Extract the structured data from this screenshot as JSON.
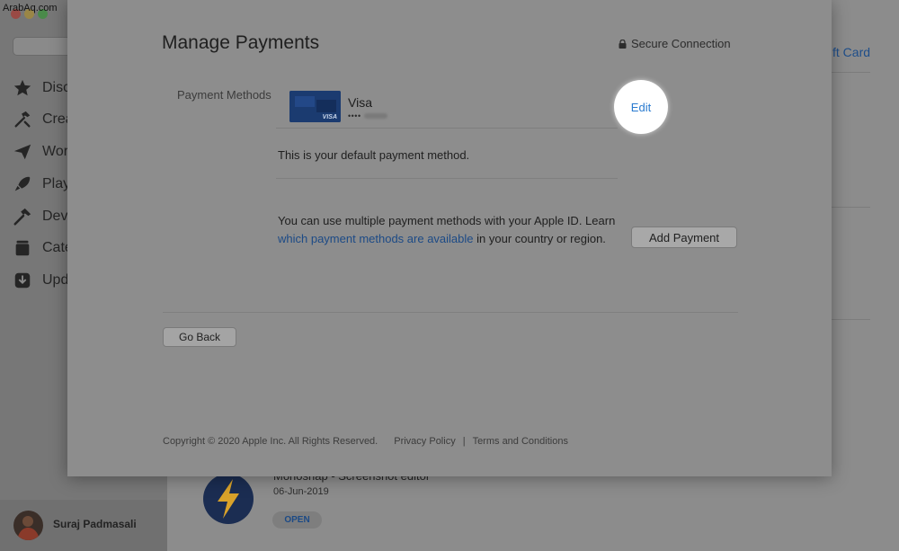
{
  "watermark": "ArabAq.com",
  "sidebar": {
    "search_glyph": "Q",
    "items": [
      {
        "label": "Disc",
        "icon": "star-icon"
      },
      {
        "label": "Crea",
        "icon": "hammer-brush-icon"
      },
      {
        "label": "Wor",
        "icon": "paper-plane-icon"
      },
      {
        "label": "Play",
        "icon": "rocket-icon"
      },
      {
        "label": "Dev",
        "icon": "hammer-icon"
      },
      {
        "label": "Cate",
        "icon": "stack-icon"
      },
      {
        "label": "Upd",
        "icon": "download-icon"
      }
    ],
    "user_name": "Suraj Padmasali"
  },
  "main": {
    "gift_card_link": "ft Card",
    "app_title": "Monoshap - Screenshot editor",
    "app_date": "06-Jun-2019",
    "open_button": "OPEN"
  },
  "modal": {
    "title": "Manage Payments",
    "secure_connection": "Secure Connection",
    "payment_methods_label": "Payment Methods",
    "card": {
      "brand": "Visa",
      "card_mark": "VISA",
      "masked_number": "••••"
    },
    "edit_button": "Edit",
    "default_text": "This is your default payment method.",
    "multi_text_1": "You can use multiple payment methods with your Apple ID. Learn ",
    "multi_link": "which payment methods are available",
    "multi_text_2": " in your country or region.",
    "add_payment_button": "Add Payment",
    "go_back_button": "Go Back",
    "footer": {
      "copyright": "Copyright © 2020 Apple Inc. All Rights Reserved.",
      "privacy": "Privacy Policy",
      "separator": "|",
      "terms": "Terms and Conditions"
    }
  },
  "colors": {
    "link_blue": "#2a7bd0",
    "card_blue": "#1a3a6e",
    "highlight": "#ffffff"
  }
}
